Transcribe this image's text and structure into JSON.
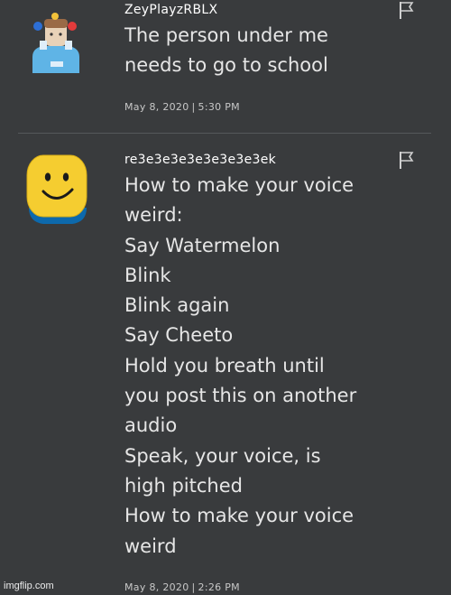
{
  "comments": [
    {
      "username": "ZeyPlayzRBLX",
      "text": "The person under me\nneeds to go to school",
      "date": "May 8, 2020",
      "time": "5:30 PM",
      "avatar_icon": "roblox-character-avatar",
      "flag_icon": "report-flag-icon"
    },
    {
      "username": "re3e3e3e3e3e3e3e3ek",
      "text": "How to make your voice\nweird:\nSay Watermelon\nBlink\nBlink again\nSay Cheeto\nHold you breath until\nyou post this on another\naudio\nSpeak, your voice, is\nhigh pitched\nHow to make your voice\nweird",
      "date": "May 8, 2020",
      "time": "2:26 PM",
      "avatar_icon": "roblox-noob-smiley-avatar",
      "flag_icon": "report-flag-icon"
    }
  ],
  "separator": "|",
  "watermark": "imgflip.com",
  "colors": {
    "background": "#393b3d",
    "text": "#ffffff",
    "noob_yellow": "#f5cd30",
    "noob_blue": "#0d69ac"
  }
}
